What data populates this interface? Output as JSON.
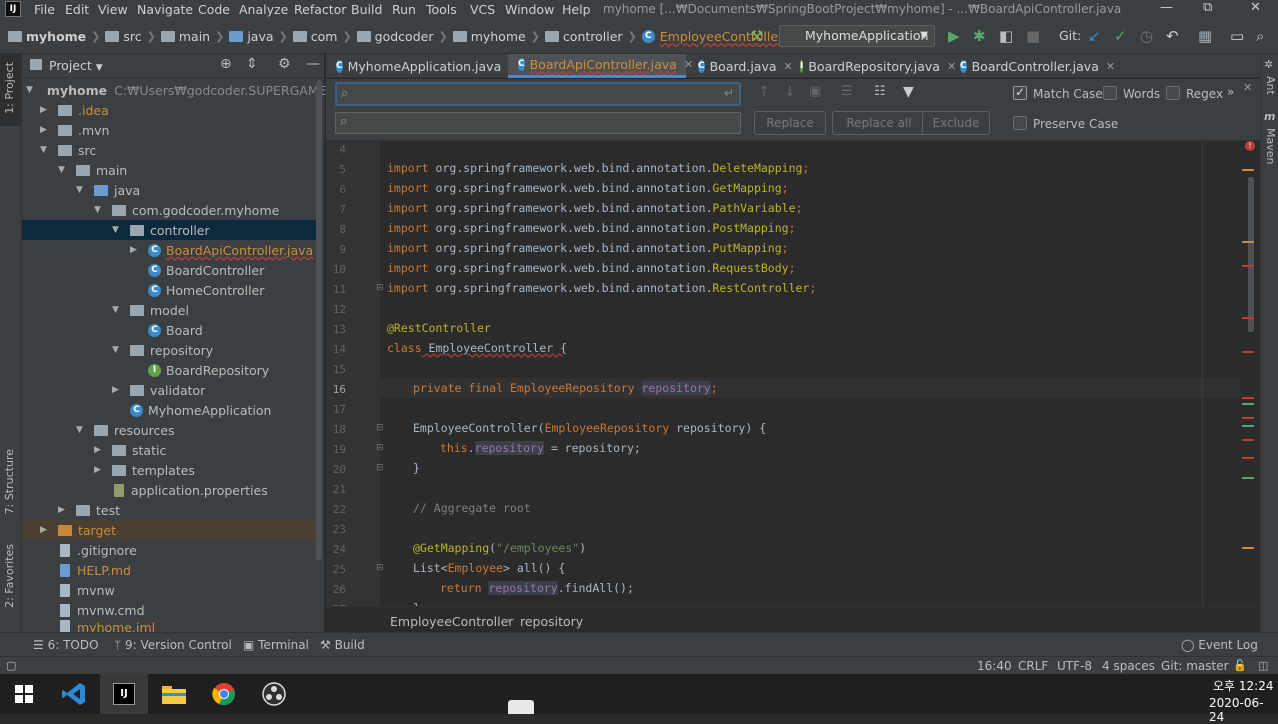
{
  "menubar": {
    "app_icon": "IJ",
    "items": [
      "File",
      "Edit",
      "View",
      "Navigate",
      "Code",
      "Analyze",
      "Refactor",
      "Build",
      "Run",
      "Tools",
      "VCS",
      "Window",
      "Help"
    ],
    "window_title": "myhome [...₩Documents₩SpringBootProject₩myhome] - ...₩BoardApiController.java",
    "minimize": "—",
    "restore": "⧉",
    "close": "✕"
  },
  "navbar": {
    "crumbs": [
      "myhome",
      "src",
      "main",
      "java",
      "com",
      "godcoder",
      "myhome",
      "controller",
      "EmployeeController"
    ],
    "run_config": "MyhomeApplication",
    "git_label": "Git:"
  },
  "left_stripe": {
    "project_tab": "1: Project",
    "structure_tab": "7: Structure",
    "favorites_tab": "2: Favorites"
  },
  "right_stripe": {
    "ant_tab": "Ant",
    "maven_tab": "Maven"
  },
  "project": {
    "header": "Project",
    "root_name": "myhome",
    "root_path": "C:₩Users₩godcoder.SUPERGAME₩Do",
    "nodes": {
      "idea": ".idea",
      "mvn": ".mvn",
      "src": "src",
      "main": "main",
      "java": "java",
      "pkg": "com.godcoder.myhome",
      "controller": "controller",
      "boardapi": "BoardApiController.java",
      "boardctl": "BoardController",
      "homectl": "HomeController",
      "model": "model",
      "board": "Board",
      "repository": "repository",
      "boardrepo": "BoardRepository",
      "validator": "validator",
      "myhomeapp": "MyhomeApplication",
      "resources": "resources",
      "static": "static",
      "templates": "templates",
      "appprops": "application.properties",
      "test": "test",
      "target": "target",
      "gitignore": ".gitignore",
      "helpmd": "HELP.md",
      "mvnw": "mvnw",
      "mvnwcmd": "mvnw.cmd",
      "myhomeiml": "myhome.iml"
    }
  },
  "tabs": [
    {
      "label": "MyhomeApplication.java",
      "badge": "C"
    },
    {
      "label": "BoardApiController.java",
      "badge": "C"
    },
    {
      "label": "Board.java",
      "badge": "C"
    },
    {
      "label": "BoardRepository.java",
      "badge": "I"
    },
    {
      "label": "BoardController.java",
      "badge": "C"
    }
  ],
  "find": {
    "search_value": "",
    "replace_value": "",
    "match_case": "Match Case",
    "words": "Words",
    "regex": "Regex",
    "preserve_case": "Preserve Case",
    "replace": "Replace",
    "replace_all": "Replace all",
    "exclude": "Exclude"
  },
  "editor": {
    "line_numbers": [
      "4",
      "5",
      "6",
      "7",
      "8",
      "9",
      "10",
      "11",
      "12",
      "13",
      "14",
      "15",
      "16",
      "17",
      "18",
      "19",
      "20",
      "21",
      "22",
      "23",
      "24",
      "25",
      "26",
      "27"
    ],
    "imports": [
      {
        "kw": "import",
        "pkg": " org.springframework.web.bind.annotation.",
        "cls": "DeleteMapping",
        "end": ";"
      },
      {
        "kw": "import",
        "pkg": " org.springframework.web.bind.annotation.",
        "cls": "GetMapping",
        "end": ";"
      },
      {
        "kw": "import",
        "pkg": " org.springframework.web.bind.annotation.",
        "cls": "PathVariable",
        "end": ";"
      },
      {
        "kw": "import",
        "pkg": " org.springframework.web.bind.annotation.",
        "cls": "PostMapping",
        "end": ";"
      },
      {
        "kw": "import",
        "pkg": " org.springframework.web.bind.annotation.",
        "cls": "PutMapping",
        "end": ";"
      },
      {
        "kw": "import",
        "pkg": " org.springframework.web.bind.annotation.",
        "cls": "RequestBody",
        "end": ";"
      },
      {
        "kw": "import",
        "pkg": " org.springframework.web.bind.annotation.",
        "cls": "RestController",
        "end": ";"
      }
    ],
    "annotation_rest": "@RestController",
    "kw_class": "class",
    "class_name": " EmployeeController {",
    "kw_private_final": "private final ",
    "field_type": "EmployeeRepository",
    "field_name": "repository",
    "semicolon": ";",
    "ctor_name": "EmployeeController(",
    "ctor_param_type": "EmployeeRepository",
    "ctor_param_rest": " repository) {",
    "kw_this": "this",
    "this_dot": ".",
    "this_field": "repository",
    "this_assign": " = repository;",
    "close_brace": "}",
    "comment": "// Aggregate root",
    "annotation_get": "@GetMapping",
    "get_open": "(",
    "get_path": "\"/employees\"",
    "get_close": ")",
    "list_open": "List<",
    "list_type": "Employee",
    "list_rest": "> all() {",
    "kw_return": "return",
    "return_field": "repository",
    "return_rest": ".findAll();",
    "partial": "}"
  },
  "editor_breadcrumb": [
    "EmployeeController",
    "repository"
  ],
  "toolwindows": [
    "6: TODO",
    "9: Version Control",
    "Terminal",
    "Build",
    "Event Log"
  ],
  "status": {
    "position": "16:40",
    "line_sep": "CRLF",
    "encoding": "UTF-8",
    "indent": "4 spaces",
    "branch": "Git: master"
  },
  "taskbar": {
    "time": "오후 12:24",
    "date": "2020-06-24"
  },
  "colors": {
    "accent": "#4a88c7",
    "background": "#2b2b2b",
    "panel": "#3c3f41"
  }
}
